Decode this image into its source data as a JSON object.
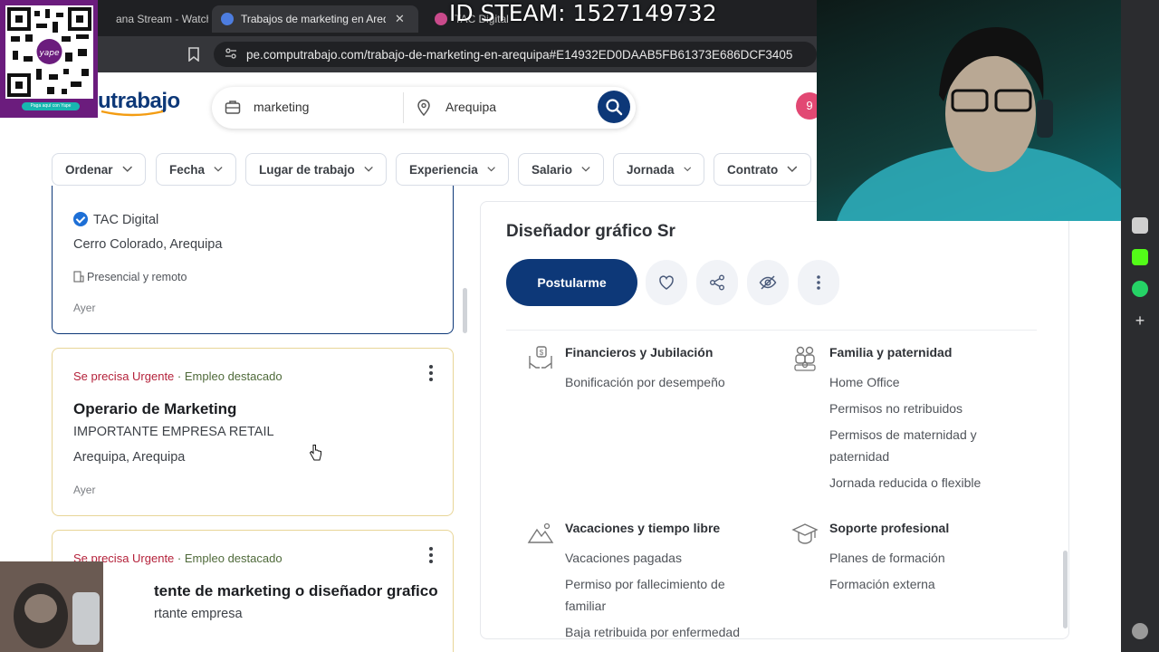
{
  "browser": {
    "tabs": [
      {
        "label": "ana Stream - Watch Li",
        "active": false
      },
      {
        "label": "Trabajos de marketing en Arequi",
        "active": true
      },
      {
        "label": "TAC Digital",
        "active": false
      }
    ],
    "tab_close": "✕",
    "url": "pe.computrabajo.com/trabajo-de-marketing-en-arequipa#E14932ED0DAAB5FB61373E686DCF3405"
  },
  "overlay": {
    "steam_id": "ID STEAM: 1527149732",
    "qr_caption": "Paga aquí con Yape"
  },
  "header": {
    "logo_text": "utrabajo",
    "search_keyword": "marketing",
    "search_location": "Arequipa",
    "notifications": "9"
  },
  "filters": [
    "Ordenar",
    "Fecha",
    "Lugar de trabajo",
    "Experiencia",
    "Salario",
    "Jornada",
    "Contrato"
  ],
  "jobs": [
    {
      "company": "TAC Digital",
      "location": "Cerro Colorado, Arequipa",
      "mode": "Presencial y remoto",
      "date": "Ayer"
    },
    {
      "urgent": "Se precisa Urgente",
      "dot": "·",
      "featured": "Empleo destacado",
      "title": "Operario de Marketing",
      "company": "IMPORTANTE EMPRESA RETAIL",
      "location": "Arequipa, Arequipa",
      "date": "Ayer"
    },
    {
      "urgent": "Se precisa Urgente",
      "dot": "·",
      "featured": "Empleo destacado",
      "title": "tente de marketing o diseñador grafico",
      "company": "rtante empresa"
    }
  ],
  "detail": {
    "title": "Diseñador gráfico Sr",
    "apply": "Postularme",
    "benefits": [
      {
        "icon": "money-hand-icon",
        "heading": "Financieros y Jubilación",
        "items": [
          "Bonificación por desempeño"
        ]
      },
      {
        "icon": "family-icon",
        "heading": "Familia y paternidad",
        "items": [
          "Home Office",
          "Permisos no retribuidos",
          "Permisos de maternidad y paternidad",
          "Jornada reducida o flexible"
        ]
      },
      {
        "icon": "mountain-icon",
        "heading": "Vacaciones y tiempo libre",
        "items": [
          "Vacaciones pagadas",
          "Permiso por fallecimiento de familiar",
          "Baja retribuida por enfermedad"
        ]
      },
      {
        "icon": "graduation-cap-icon",
        "heading": "Soporte profesional",
        "items": [
          "Planes de formación",
          "Formación externa"
        ]
      }
    ]
  },
  "colors": {
    "brand": "#0d3878",
    "urgent": "#b4213a",
    "featured": "#4f6a3a",
    "notification": "#e24873"
  }
}
